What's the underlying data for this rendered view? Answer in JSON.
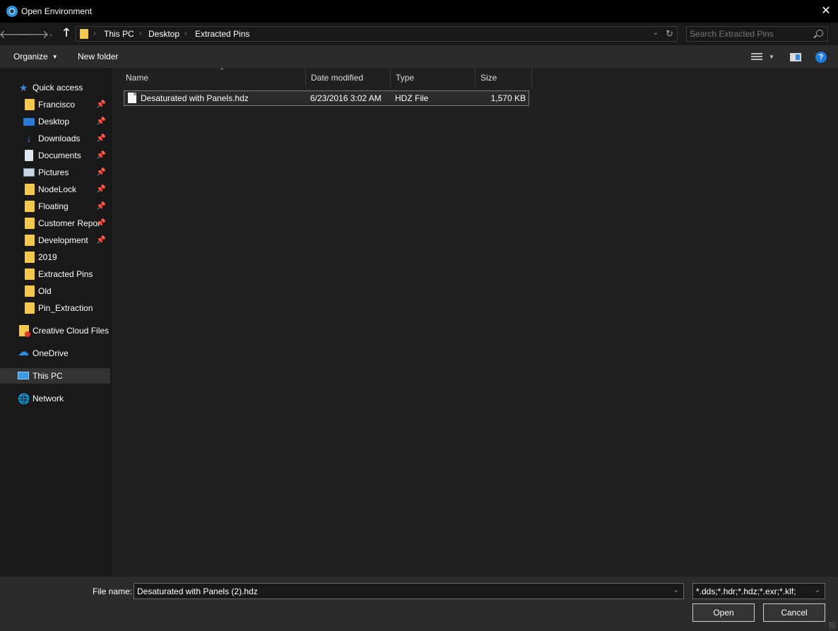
{
  "window": {
    "title": "Open Environment",
    "close_glyph": "✕"
  },
  "nav": {
    "back_glyph": "🡐",
    "forward_glyph": "🡒",
    "recent_glyph": "⌄",
    "up_glyph": "🡑",
    "breadcrumbs": [
      "This PC",
      "Desktop",
      "Extracted Pins"
    ],
    "separator": "›",
    "dropdown_glyph": "⌄",
    "refresh_glyph": "↻"
  },
  "search": {
    "placeholder": "Search Extracted Pins",
    "value": ""
  },
  "toolbar": {
    "organize_label": "Organize",
    "organize_caret": "▼",
    "new_folder_label": "New folder",
    "view_caret": "▼",
    "help_glyph": "?"
  },
  "sidebar": {
    "pin_glyph": "📌",
    "quick_access": "Quick access",
    "pinned_items": [
      "Francisco",
      "Desktop",
      "Downloads",
      "Documents",
      "Pictures",
      "NodeLock",
      "Floating",
      "Customer Repor",
      "Development"
    ],
    "unpinned_items": [
      "2019",
      "Extracted Pins",
      "Old",
      "Pin_Extraction"
    ],
    "creative_cloud": "Creative Cloud Files",
    "onedrive": "OneDrive",
    "this_pc": "This PC",
    "network": "Network",
    "glyphs": {
      "downloads": "↓",
      "star": "★",
      "cloud": "☁",
      "network": "🌐"
    }
  },
  "columns": [
    "Name",
    "Date modified",
    "Type",
    "Size"
  ],
  "sort_glyph": "^",
  "files": [
    {
      "name": "Desaturated with Panels.hdz",
      "date_modified": "6/23/2016 3:02 AM",
      "type": "HDZ File",
      "size": "1,570 KB"
    }
  ],
  "bottom": {
    "file_name_label": "File name:",
    "file_name_value": "Desaturated with Panels (2).hdz",
    "dropdown_glyph": "⌄",
    "filter_value": "*.dds;*.hdr;*.hdz;*.exr;*.klf;",
    "open_label": "Open",
    "cancel_label": "Cancel"
  },
  "colors": {
    "accent": "#2e8fe0",
    "folder": "#f2c94c",
    "background": "#202020",
    "panel": "#2b2b2b"
  }
}
